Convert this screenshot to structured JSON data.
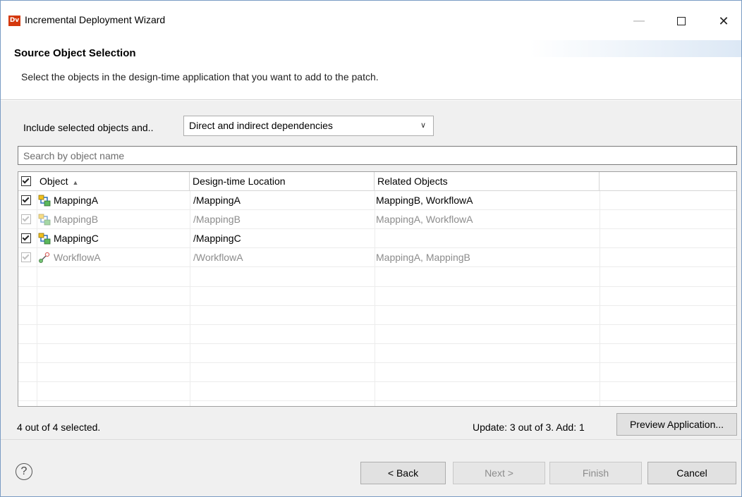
{
  "window": {
    "title": "Incremental Deployment Wizard",
    "app_icon_text": "Dv",
    "minimize_glyph": "—",
    "close_glyph": "✕"
  },
  "header": {
    "title": "Source Object Selection",
    "description": "Select the objects in the design-time application that you want to add to the patch."
  },
  "include": {
    "label": "Include selected objects and..",
    "selected": "Direct and indirect dependencies",
    "arrow_glyph": "∨"
  },
  "search": {
    "placeholder": "Search by object name"
  },
  "table": {
    "columns": {
      "object": "Object",
      "location": "Design-time Location",
      "related": "Related Objects",
      "sort_glyph": "▲"
    },
    "rows": [
      {
        "name": "MappingA",
        "location": "/MappingA",
        "related": "MappingB, WorkflowA",
        "type": "mapping",
        "checked": true,
        "dimmed": false
      },
      {
        "name": "MappingB",
        "location": "/MappingB",
        "related": "MappingA, WorkflowA",
        "type": "mapping",
        "checked": true,
        "dimmed": true
      },
      {
        "name": "MappingC",
        "location": "/MappingC",
        "related": "",
        "type": "mapping",
        "checked": true,
        "dimmed": false
      },
      {
        "name": "WorkflowA",
        "location": "/WorkflowA",
        "related": "MappingA, MappingB",
        "type": "workflow",
        "checked": true,
        "dimmed": true
      }
    ]
  },
  "status": {
    "selected_text": "4 out of 4 selected.",
    "update_text": "Update: 3 out of 3.  Add: 1"
  },
  "buttons": {
    "preview": "Preview Application...",
    "back": "< Back",
    "next": "Next >",
    "finish": "Finish",
    "cancel": "Cancel",
    "help_glyph": "?"
  },
  "colors": {
    "accent": "#d4380d",
    "disabled_text": "#8c8c8c"
  }
}
